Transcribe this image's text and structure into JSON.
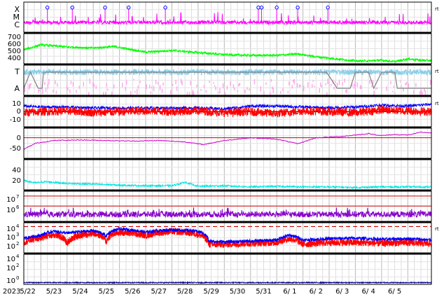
{
  "chart_data": {
    "type": "line",
    "x_axis": {
      "year_label": "2023",
      "date_ticks": [
        "5/22",
        "5/23",
        "5/24",
        "5/25",
        "5/26",
        "5/27",
        "5/28",
        "5/29",
        "5/30",
        "5/31",
        "6/ 1",
        "6/ 2",
        "6/ 3",
        "6/ 4",
        "6/ 5"
      ],
      "start_day": 0.35,
      "end_day": 15.9,
      "gridlines": "vertical, 4 per day"
    },
    "panels": [
      {
        "id": "class",
        "type": "line",
        "tick_labels": [
          "X",
          "M",
          "C"
        ],
        "right_tag": "rt",
        "series": [
          {
            "color": "#ff00ff",
            "level_estimate": "mostly between C and M, spikes to X"
          }
        ],
        "markers": {
          "color": "#0000ff",
          "days": [
            1.25,
            2.2,
            3.45,
            4.35,
            5.75,
            9.3,
            9.42,
            10.0,
            10.8,
            11.95
          ],
          "level": 0.82
        }
      },
      {
        "id": "speed",
        "type": "line",
        "yticks": [
          400,
          500,
          600,
          700
        ],
        "ylim": [
          330,
          760
        ],
        "series": [
          {
            "color": "#00ff00",
            "x": [
              0.35,
              1.0,
              2.0,
              3.0,
              3.8,
              4.5,
              5.0,
              6.0,
              7.0,
              8.0,
              9.0,
              10.0,
              10.8,
              11.5,
              12.5,
              13.0,
              13.5,
              14.0,
              14.5,
              15.0,
              15.5,
              15.9
            ],
            "y": [
              530,
              600,
              570,
              555,
              575,
              530,
              495,
              520,
              490,
              460,
              450,
              450,
              470,
              430,
              390,
              370,
              370,
              380,
              360,
              400,
              380,
              375
            ]
          }
        ]
      },
      {
        "id": "magnetic",
        "type": "line",
        "tick_labels": [
          "T",
          "A"
        ],
        "right_tag": "rt",
        "series": [
          {
            "color": "#87ceeb",
            "level_estimate": "near T band"
          },
          {
            "color": "#ffaaee",
            "level_estimate": "near A band, scattered"
          },
          {
            "color": "#808080",
            "level_estimate": "step line between bands"
          }
        ]
      },
      {
        "id": "bfield",
        "type": "line",
        "yticks": [
          -10,
          0,
          10
        ],
        "ylim": [
          -16,
          16
        ],
        "right_tag": "rt",
        "series": [
          {
            "color": "#0000ff",
            "x": [
              0.35,
              1.0,
              2.0,
              3.0,
              4.0,
              5.0,
              6.0,
              7.0,
              8.0,
              9.0,
              10.0,
              11.0,
              12.0,
              13.0,
              14.0,
              15.0,
              15.9
            ],
            "y": [
              6,
              5,
              5,
              4,
              4,
              4,
              4,
              4,
              3,
              6,
              6,
              5,
              4,
              5,
              7,
              6,
              8
            ]
          },
          {
            "color": "#ff0000",
            "x": [
              0.35,
              1.0,
              2.0,
              3.0,
              4.0,
              5.0,
              6.0,
              7.0,
              8.0,
              9.0,
              10.0,
              11.0,
              12.0,
              13.0,
              14.0,
              15.0,
              15.9
            ],
            "y": [
              -1,
              0,
              1,
              -1,
              0,
              1,
              0,
              1,
              -1,
              0,
              -2,
              1,
              0,
              -1,
              2,
              1,
              0
            ]
          }
        ]
      },
      {
        "id": "bz_long",
        "type": "line",
        "yticks": [
          -50,
          0
        ],
        "ylim": [
          -75,
          35
        ],
        "series": [
          {
            "color": "#cc00cc",
            "x": [
              0.35,
              0.8,
              1.5,
              2.5,
              3.5,
              4.5,
              5.5,
              6.5,
              7.2,
              8.0,
              9.0,
              10.0,
              10.8,
              11.5,
              12.5,
              13.0,
              13.5,
              14.0,
              14.5,
              15.0,
              15.5,
              15.9
            ],
            "y": [
              -42,
              -20,
              -10,
              -8,
              -10,
              -12,
              -10,
              -15,
              -25,
              -10,
              0,
              -5,
              -22,
              0,
              5,
              10,
              15,
              8,
              12,
              10,
              20,
              18
            ]
          }
        ]
      },
      {
        "id": "density",
        "type": "line",
        "yticks": [
          20,
          40
        ],
        "ylim": [
          0,
          52
        ],
        "series": [
          {
            "color": "#00e5e5",
            "x": [
              0.35,
              0.8,
              1.2,
              2.0,
              3.0,
              4.0,
              5.0,
              6.0,
              6.5,
              7.0,
              8.0,
              9.0,
              10.0,
              11.0,
              12.0,
              13.0,
              14.0,
              15.0,
              15.9
            ],
            "y": [
              16,
              12,
              14,
              11,
              10,
              8,
              7,
              7,
              13,
              6,
              7,
              5,
              6,
              5,
              5,
              4,
              5,
              5,
              5
            ]
          }
        ]
      },
      {
        "id": "temperature",
        "type": "line",
        "tick_labels": [
          "10^7",
          "10^6"
        ],
        "yscale": "log",
        "ylim": [
          30000,
          30000000
        ],
        "reference_lines": [
          {
            "value": 10000000,
            "color": "#cc0000"
          },
          {
            "value": 1000000,
            "color": "#cc0000"
          }
        ],
        "series": [
          {
            "color": "#8800cc",
            "level_estimate": "about 1e5–5e5"
          }
        ]
      },
      {
        "id": "electrons",
        "type": "line",
        "tick_labels": [
          "10^4",
          "10^3",
          "10^2",
          "10^1"
        ],
        "yscale": "log",
        "ylim": [
          5,
          30000
        ],
        "right_tag": "rt",
        "reference_lines": [
          {
            "value": 10000,
            "color": "#cc0000",
            "style": "dashed"
          }
        ],
        "series": [
          {
            "color": "#0000ff",
            "x": [
              0.35,
              1.0,
              1.5,
              2.0,
              3.0,
              3.5,
              4.0,
              5.0,
              6.0,
              6.8,
              7.1,
              7.4,
              8.0,
              9.0,
              10.0,
              10.5,
              11.0,
              12.0,
              13.0,
              14.0,
              15.0,
              15.9
            ],
            "y": [
              300,
              800,
              2500,
              1500,
              3000,
              600,
              5000,
              2000,
              4000,
              3000,
              2000,
              150,
              120,
              150,
              200,
              800,
              200,
              300,
              350,
              250,
              300,
              200
            ]
          },
          {
            "color": "#ff0000",
            "x": [
              0.35,
              1.0,
              1.5,
              2.0,
              3.0,
              3.5,
              4.0,
              5.0,
              6.0,
              6.8,
              7.1,
              7.4,
              8.0,
              9.0,
              10.0,
              10.5,
              11.0,
              12.0,
              13.0,
              14.0,
              15.0,
              15.9
            ],
            "y": [
              100,
              400,
              1000,
              60,
              1500,
              100,
              2000,
              800,
              2500,
              1500,
              800,
              60,
              60,
              80,
              100,
              300,
              60,
              100,
              100,
              80,
              100,
              70
            ]
          }
        ]
      },
      {
        "id": "protons",
        "type": "line",
        "tick_labels": [
          "10^4",
          "10^2",
          "10^0"
        ],
        "yscale": "log",
        "ylim": [
          0.5,
          50000
        ],
        "series": [
          {
            "color": "#00008b",
            "level_estimate": "about 1"
          }
        ]
      }
    ]
  }
}
